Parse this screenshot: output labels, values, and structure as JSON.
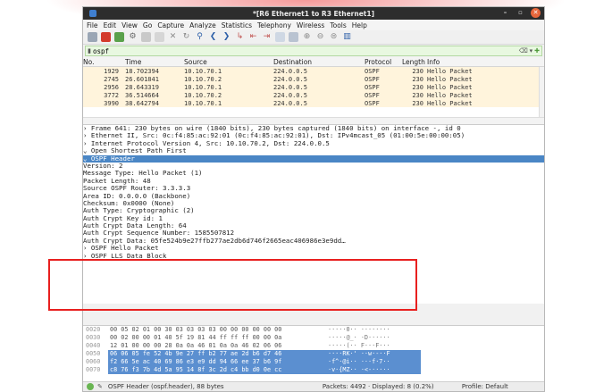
{
  "window": {
    "title": "*[R6 Ethernet1 to R3 Ethernet1]"
  },
  "menu": [
    "File",
    "Edit",
    "View",
    "Go",
    "Capture",
    "Analyze",
    "Statistics",
    "Telephony",
    "Wireless",
    "Tools",
    "Help"
  ],
  "filter": {
    "value": "ospf"
  },
  "packet_list": {
    "headers": {
      "no": "No.",
      "time": "Time",
      "source": "Source",
      "destination": "Destination",
      "protocol": "Protocol",
      "length": "Length",
      "info": "Info"
    },
    "rows": [
      {
        "no": "1929",
        "time": "18.702394",
        "source": "10.10.70.1",
        "destination": "224.0.0.5",
        "protocol": "OSPF",
        "length": "230",
        "info": "Hello Packet"
      },
      {
        "no": "2745",
        "time": "26.601841",
        "source": "10.10.70.2",
        "destination": "224.0.0.5",
        "protocol": "OSPF",
        "length": "230",
        "info": "Hello Packet"
      },
      {
        "no": "2956",
        "time": "28.643319",
        "source": "10.10.70.1",
        "destination": "224.0.0.5",
        "protocol": "OSPF",
        "length": "230",
        "info": "Hello Packet"
      },
      {
        "no": "3772",
        "time": "36.514664",
        "source": "10.10.70.2",
        "destination": "224.0.0.5",
        "protocol": "OSPF",
        "length": "230",
        "info": "Hello Packet"
      },
      {
        "no": "3990",
        "time": "38.642794",
        "source": "10.10.70.1",
        "destination": "224.0.0.5",
        "protocol": "OSPF",
        "length": "230",
        "info": "Hello Packet"
      }
    ]
  },
  "details": [
    "› Frame 641: 230 bytes on wire (1840 bits), 230 bytes captured (1840 bits) on interface -, id 0",
    "› Ethernet II, Src: 0c:f4:85:ac:92:01 (0c:f4:85:ac:92:01), Dst: IPv4mcast_05 (01:00:5e:00:00:05)",
    "› Internet Protocol Version 4, Src: 10.10.70.2, Dst: 224.0.0.5",
    "⌄ Open Shortest Path First",
    "    ⌄ OSPF Header",
    "        Version: 2",
    "        Message Type: Hello Packet (1)",
    "        Packet Length: 48",
    "        Source OSPF Router: 3.3.3.3",
    "        Area ID: 0.0.0.0 (Backbone)",
    "        Checksum: 0x0000 (None)",
    "        Auth Type: Cryptographic (2)",
    "        Auth Crypt Key id: 1",
    "        Auth Crypt Data Length: 64",
    "        Auth Crypt Sequence Number: 1585507812",
    "        Auth Crypt Data: 05fe524b9e27ffb277ae2db6d746f2665eac406986e3e9dd…",
    "    › OSPF Hello Packet",
    "    › OSPF LLS Data Block"
  ],
  "hex": [
    {
      "off": "0020",
      "bytes": "00 05 02 01 00 30 03 03  03 03 00 00 00 00 00 00",
      "ascii": "·····0·· ········"
    },
    {
      "off": "0030",
      "bytes": "00 02 00 00 01 40 5f 19  81 44 ff ff ff 00 00 0a",
      "ascii": "·····@_· ·D······"
    },
    {
      "off": "0040",
      "bytes": "12 01 00 00 00 28 0a 0a  46 01 0a 0a 46 02 06 06",
      "ascii": "·····(·· F···F···"
    },
    {
      "off": "0050",
      "bytes": "06 06 05 fe 52 4b 9e 27  ff b2 77 ae 2d b6 d7 46",
      "ascii": "····RK·' ··w·-··F"
    },
    {
      "off": "0060",
      "bytes": "f2 66 5e ac 40 69 86 e3  e9 dd 94 66 ee 37 b6 9f",
      "ascii": "·f^·@i·· ···f·7··"
    },
    {
      "off": "0070",
      "bytes": "c8 76 f3 7b 4d 5a 95 14  8f 3c 2d c4 bb d0 0e cc",
      "ascii": "·v·{MZ·· ·<-·····"
    }
  ],
  "status": {
    "left": "OSPF Header (ospf.header), 88 bytes",
    "packets": "Packets: 4492 · Displayed: 8 (0.2%)",
    "profile": "Profile: Default"
  }
}
